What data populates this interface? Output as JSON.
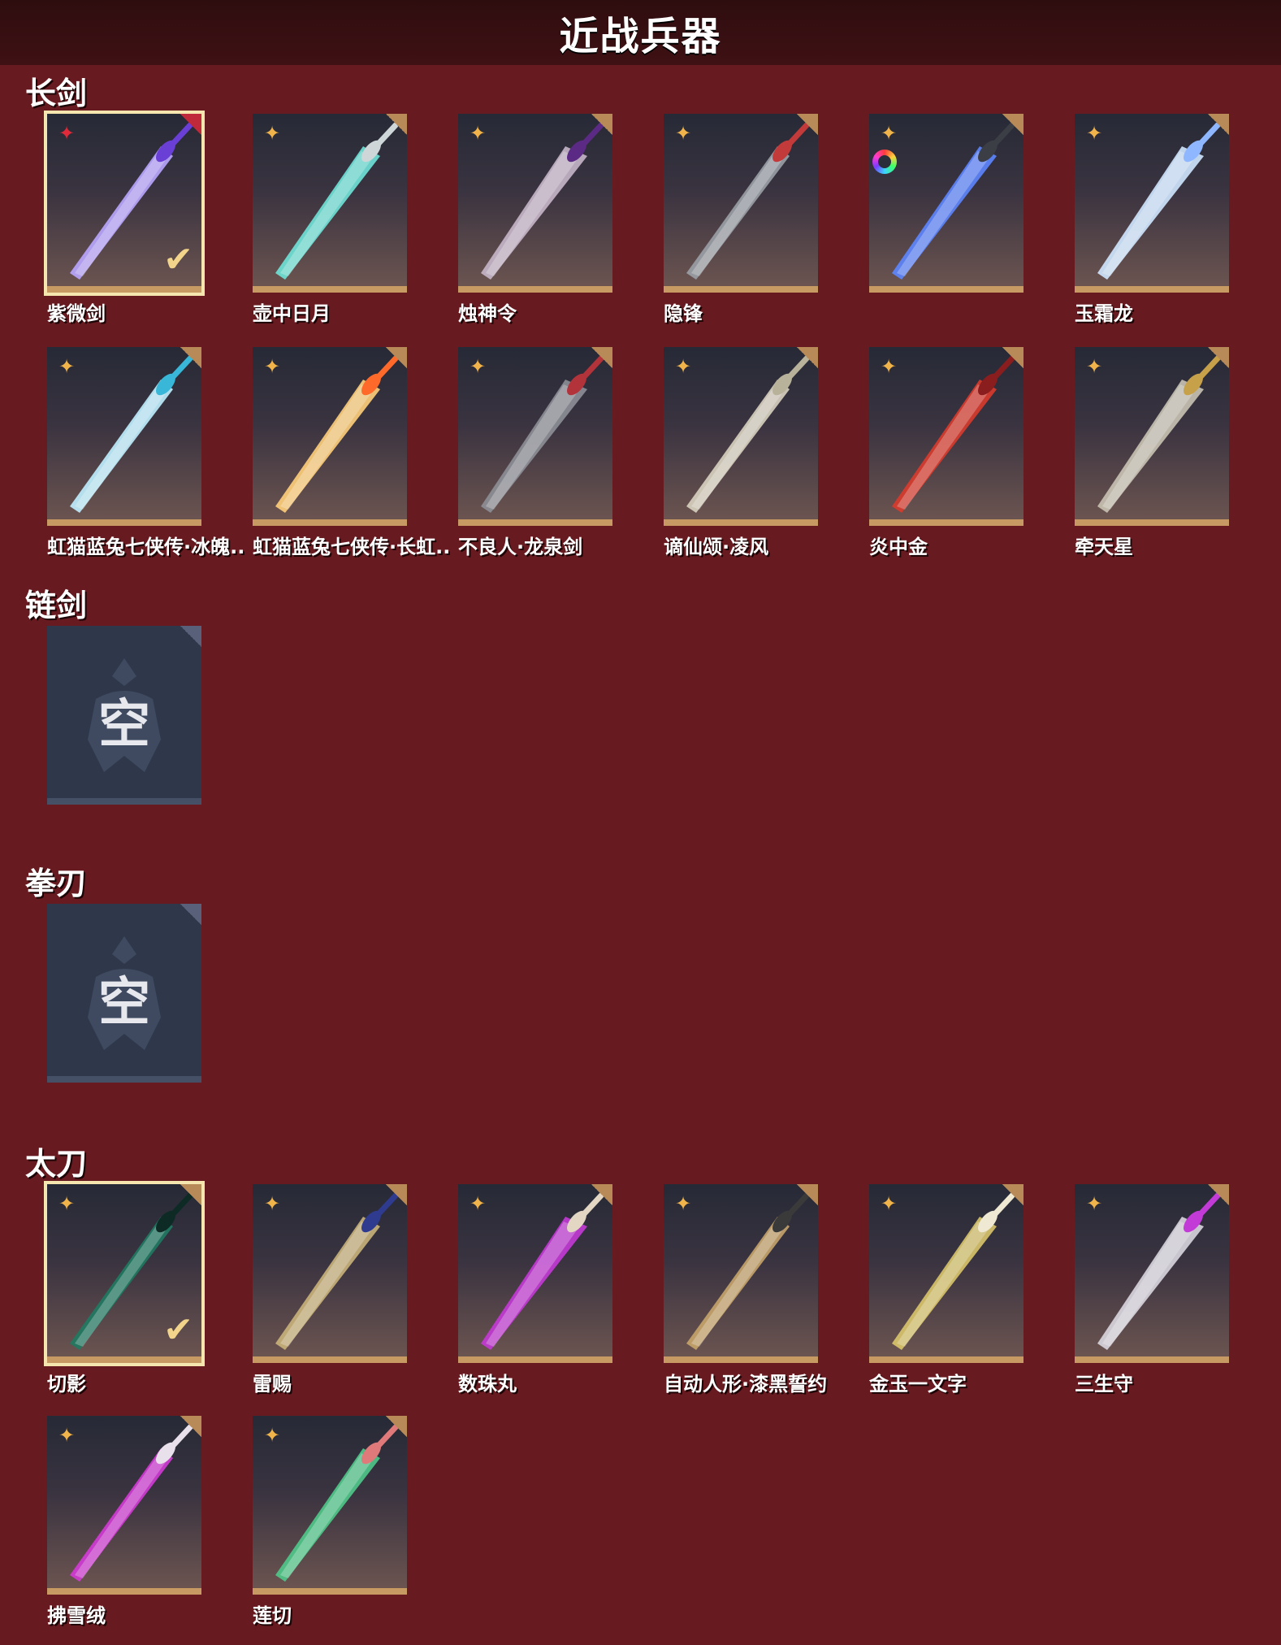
{
  "header": {
    "title": "近战兵器"
  },
  "sections": [
    {
      "title": "长剑",
      "items": [
        {
          "name": "紫微剑",
          "selected": true,
          "rarity": "red",
          "blade": "#b9a6ff",
          "hilt": "#6a3fd6"
        },
        {
          "name": "壶中日月",
          "blade": "#6fe3d8",
          "hilt": "#cfd6d8"
        },
        {
          "name": "烛神令",
          "blade": "#c7b6c9",
          "hilt": "#5b2a84"
        },
        {
          "name": "隐锋",
          "blade": "#9aa0a6",
          "hilt": "#c23a3a"
        },
        {
          "name": "",
          "ring": true,
          "blade": "#5d86ff",
          "hilt": "#3b3e45"
        },
        {
          "name": "玉霜龙",
          "blade": "#cfe7ff",
          "hilt": "#8fb7ff"
        },
        {
          "name": "虹猫蓝兔七侠传·冰魄..",
          "blade": "#bfefff",
          "hilt": "#39b7d8"
        },
        {
          "name": "虹猫蓝兔七侠传·长虹..",
          "blade": "#ffcf7a",
          "hilt": "#ff6a2a"
        },
        {
          "name": "不良人·龙泉剑",
          "blade": "#8d8f97",
          "hilt": "#b3333b"
        },
        {
          "name": "谪仙颂·凌风",
          "blade": "#d8d2c0",
          "hilt": "#b8b29a"
        },
        {
          "name": "炎中金",
          "blade": "#d93b2c",
          "hilt": "#8a1d1d"
        },
        {
          "name": "牵天星",
          "blade": "#c9c3b4",
          "hilt": "#c7a04a"
        }
      ]
    },
    {
      "title": "链剑",
      "items": [
        {
          "name": "",
          "empty": true,
          "empty_text": "空"
        }
      ]
    },
    {
      "title": "拳刃",
      "items": [
        {
          "name": "",
          "empty": true,
          "empty_text": "空"
        }
      ]
    },
    {
      "title": "太刀",
      "items": [
        {
          "name": "切影",
          "selected": true,
          "blade": "#1f7a62",
          "hilt": "#0e2a25"
        },
        {
          "name": "雷赐",
          "blade": "#c9b37a",
          "hilt": "#2f3b8f"
        },
        {
          "name": "数珠丸",
          "blade": "#c43ad6",
          "hilt": "#e3d6c3"
        },
        {
          "name": "自动人形·漆黑誓约",
          "blade": "#c7a46a",
          "hilt": "#3a3a3a"
        },
        {
          "name": "金玉一文字",
          "blade": "#d9c56a",
          "hilt": "#efe9d3"
        },
        {
          "name": "三生守",
          "blade": "#d9d6df",
          "hilt": "#c23bd6"
        },
        {
          "name": "拂雪绒",
          "blade": "#d33bd6",
          "hilt": "#e8e0ea"
        },
        {
          "name": "莲切",
          "blade": "#4fc98a",
          "hilt": "#e07a7a"
        }
      ]
    }
  ]
}
